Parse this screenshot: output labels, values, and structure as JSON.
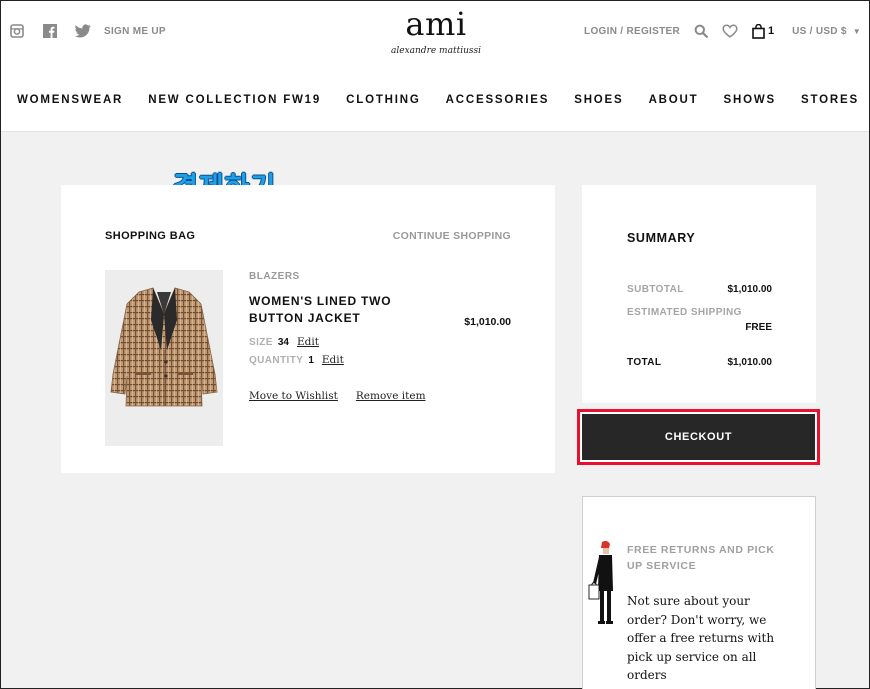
{
  "header": {
    "social_icons": [
      "instagram-icon",
      "facebook-icon",
      "twitter-icon"
    ],
    "signup": "SIGN ME UP",
    "logo": "ami",
    "logo_sub": "alexandre mattiussi",
    "login": "LOGIN / REGISTER",
    "bag_count": "1",
    "currency": "US / USD $"
  },
  "nav": [
    "WOMENSWEAR",
    "NEW COLLECTION FW19",
    "CLOTHING",
    "ACCESSORIES",
    "SHOES",
    "ABOUT",
    "SHOWS",
    "STORES"
  ],
  "annotation": "결제하기",
  "bag": {
    "title": "SHOPPING BAG",
    "continue": "CONTINUE SHOPPING",
    "item": {
      "category": "BLAZERS",
      "name": "WOMEN'S LINED TWO BUTTON JACKET",
      "price": "$1,010.00",
      "size_label": "SIZE",
      "size": "34",
      "quantity_label": "QUANTITY",
      "quantity": "1",
      "edit": "Edit",
      "wishlist": "Move to Wishlist",
      "remove": "Remove item"
    }
  },
  "summary": {
    "title": "SUMMARY",
    "subtotal_label": "SUBTOTAL",
    "subtotal": "$1,010.00",
    "shipping_label": "ESTIMATED SHIPPING",
    "shipping": "FREE",
    "total_label": "TOTAL",
    "total": "$1,010.00",
    "checkout": "CHECKOUT"
  },
  "returns": {
    "title": "FREE RETURNS AND PICK UP SERVICE",
    "body": "Not sure about your order? Don't worry, we offer a free returns with pick up service on all orders"
  },
  "colors": {
    "highlight": "#e8102e",
    "annotation": "#1ea0e6",
    "button": "#272727"
  }
}
